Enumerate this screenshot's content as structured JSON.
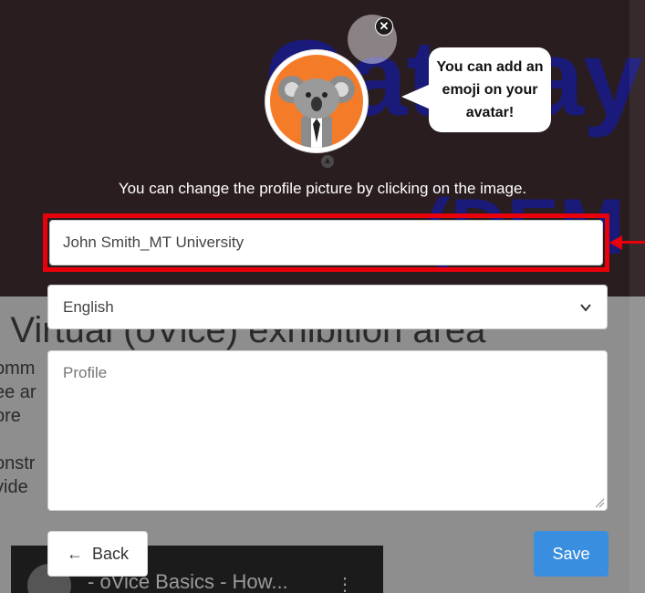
{
  "background": {
    "header_title": "Gatway",
    "header_demo": "(DEM",
    "section_heading": "e Virtual (oVice) exhibition area",
    "para_lines": [
      "omm",
      "ee ar",
      "pre",
      "",
      "onstr",
      "vide"
    ],
    "video_title": "- oVice Basics - How..."
  },
  "avatar": {
    "emoji_hint": "You can add an emoji on your avatar!",
    "close_icon": "close-icon",
    "avatar_icon": "koala-avatar"
  },
  "hint_text": "You can change the profile picture by clicking on the image.",
  "form": {
    "name_value": "John Smith_MT University",
    "language_value": "English",
    "profile_placeholder": "Profile",
    "back_label": "Back",
    "save_label": "Save"
  },
  "colors": {
    "highlight": "#e8000a",
    "save_button": "#3a8edf",
    "avatar_bg": "#f47b28"
  }
}
